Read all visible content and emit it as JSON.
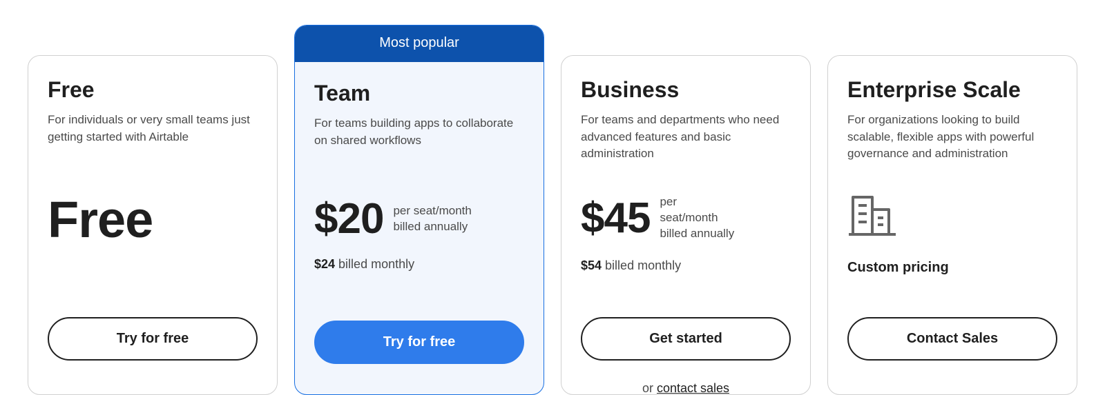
{
  "plans": [
    {
      "name": "Free",
      "desc": "For individuals or very small teams just getting started with Airtable",
      "price_display": "Free",
      "cta": "Try for free"
    },
    {
      "name": "Team",
      "banner": "Most popular",
      "desc": "For teams building apps to collaborate on shared workflows",
      "price_amount": "$20",
      "price_unit_l1": "per seat/month",
      "price_unit_l2": "billed annually",
      "alt_price_bold": "$24",
      "alt_price_rest": " billed monthly",
      "cta": "Try for free"
    },
    {
      "name": "Business",
      "desc": "For teams and departments who need advanced features and basic administration",
      "price_amount": "$45",
      "price_unit_l1": "per",
      "price_unit_l2": "seat/month",
      "price_unit_l3": "billed annually",
      "alt_price_bold": "$54",
      "alt_price_rest": " billed monthly",
      "cta": "Get started",
      "sublink_prefix": "or ",
      "sublink_text": "contact sales"
    },
    {
      "name": "Enterprise Scale",
      "desc": "For organizations looking to build scalable, flexible apps with powerful governance and administration",
      "custom_label": "Custom pricing",
      "cta": "Contact Sales"
    }
  ]
}
